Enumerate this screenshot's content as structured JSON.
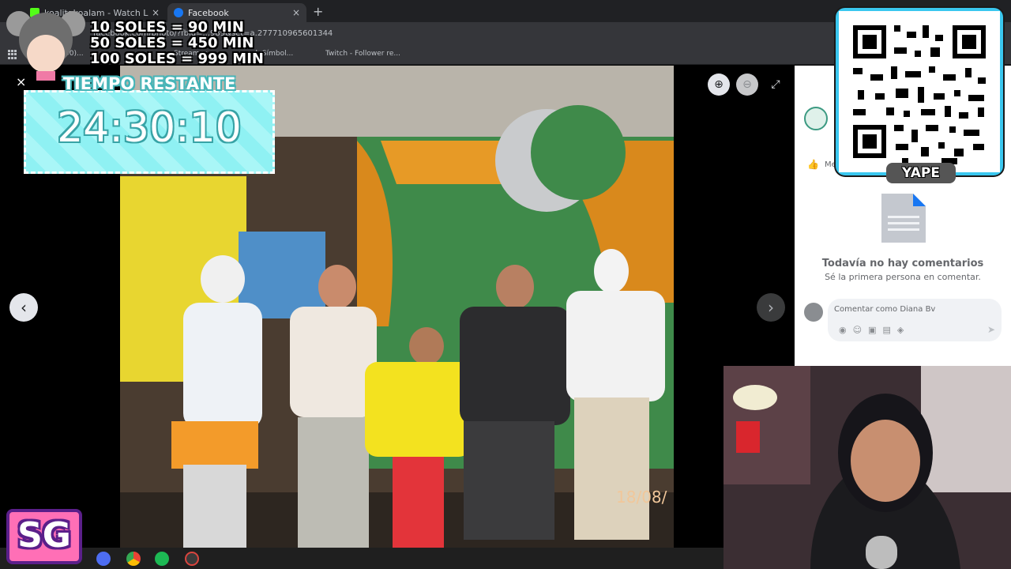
{
  "browser": {
    "tabs": [
      {
        "title": "koalitakoalam - Watch Live on K",
        "favicon_color": "#53fc18",
        "favicon": "kick-icon"
      },
      {
        "title": "Facebook",
        "favicon_color": "#1877f2",
        "favicon": "facebook-icon"
      }
    ],
    "new_tab": "+",
    "close": "×",
    "url": "facebook.com/photo/?fbid=...989&set=a.277710965601344",
    "bookmarks": [
      "Videos (750)...",
      "Streamer...",
      "el: Símbol...",
      "Twitch - Follower re..."
    ]
  },
  "viewer": {
    "photo_date": "18/08/",
    "prev": "‹",
    "next": "›",
    "zoom_in": "⊕",
    "zoom_out": "⊖",
    "expand": "⤢"
  },
  "comments": {
    "like_label": "Me",
    "empty_title": "Todavía no hay comentarios",
    "empty_subtitle": "Sé la primera persona en comentar.",
    "placeholder": "Comentar como Diana Bv"
  },
  "overlay": {
    "donations": [
      "10 SOLES = 90 MIN",
      "50 SOLES = 450 MIN",
      "100 SOLES = 999 MIN"
    ],
    "timer_title": "TIEMPO RESTANTE",
    "timer_value": "24:30:10",
    "yape_label": "YAPE",
    "sg_logo": "SG"
  },
  "colors": {
    "accent_cyan": "#8ff1f3",
    "facebook_blue": "#1877f2",
    "kick_green": "#53fc18"
  }
}
